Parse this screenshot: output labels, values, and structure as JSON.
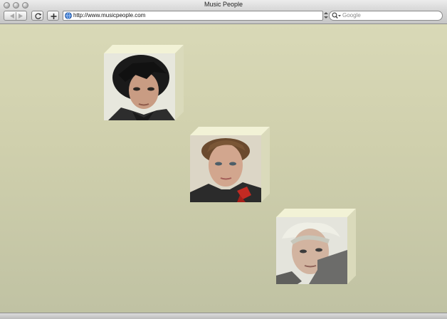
{
  "window": {
    "title": "Music People"
  },
  "toolbar": {
    "url": "http://www.musicpeople.com",
    "search_placeholder": "Google"
  },
  "icons": {
    "back": "back-arrow-icon",
    "forward": "forward-arrow-icon",
    "reload": "reload-icon",
    "add": "add-bookmark-icon",
    "globe": "globe-icon",
    "search": "magnifier-icon"
  },
  "cards": [
    {
      "subject": "person-1"
    },
    {
      "subject": "person-2"
    },
    {
      "subject": "person-3"
    }
  ],
  "colors": {
    "background": "#d4d4b2",
    "cube_light": "#f3f3d8",
    "cube_side": "#dedec0"
  }
}
